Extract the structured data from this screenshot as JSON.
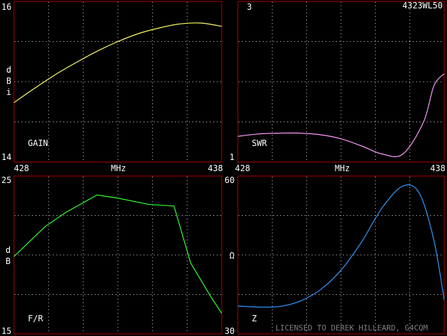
{
  "model_label": "4323WL50",
  "license_text": "LICENSED TO DEREK HILLEARD, G4CQM",
  "colors": {
    "frame": "#b00000",
    "background": "#000000",
    "grid": "#ffffff",
    "text": "#ffffff"
  },
  "chart_data": [
    {
      "id": "gain",
      "type": "line",
      "title": "GAIN",
      "ylabel": "dBi",
      "xlabel": "MHz",
      "xlim": [
        428,
        438
      ],
      "ylim": [
        14,
        16
      ],
      "xtick_labels": [
        "428",
        "438"
      ],
      "ytick_labels": [
        "16",
        "14"
      ],
      "grid": true,
      "line_color": "#ffff66",
      "x": [
        428,
        429,
        430,
        431,
        432,
        433,
        434,
        435,
        436,
        437,
        438
      ],
      "values": [
        14.74,
        14.92,
        15.09,
        15.24,
        15.38,
        15.5,
        15.6,
        15.67,
        15.72,
        15.73,
        15.69
      ]
    },
    {
      "id": "swr",
      "type": "line",
      "title": "SWR",
      "xlabel": "MHz",
      "xlim": [
        428,
        438
      ],
      "ylim": [
        1,
        3
      ],
      "xtick_labels": [
        "428",
        "438"
      ],
      "ytick_labels": [
        "3",
        "1"
      ],
      "grid": true,
      "line_color": "#ff99ff",
      "x": [
        428,
        429,
        430,
        431,
        432,
        433,
        434,
        435,
        436,
        437,
        437.5,
        438
      ],
      "values": [
        1.32,
        1.35,
        1.36,
        1.36,
        1.34,
        1.29,
        1.2,
        1.1,
        1.1,
        1.5,
        1.95,
        2.1
      ]
    },
    {
      "id": "fr",
      "type": "line",
      "title": "F/R",
      "ylabel": "dB",
      "xlim": [
        428,
        438
      ],
      "ylim": [
        15,
        25
      ],
      "ytick_labels": [
        "25",
        "15"
      ],
      "grid": true,
      "line_color": "#33ff33",
      "x": [
        428,
        429.5,
        430.5,
        432,
        433,
        434.5,
        435.7,
        436.5,
        437.5,
        438
      ],
      "values": [
        19.9,
        21.8,
        22.7,
        23.8,
        23.6,
        23.2,
        23.1,
        19.5,
        17.3,
        16.3
      ]
    },
    {
      "id": "z",
      "type": "line",
      "title": "Z",
      "ylabel": "Ω",
      "xlim": [
        428,
        438
      ],
      "ylim": [
        30,
        60
      ],
      "ytick_labels": [
        "60",
        "30"
      ],
      "grid": true,
      "line_color": "#3399ff",
      "x": [
        428,
        429,
        430,
        431,
        432,
        433,
        434,
        435,
        436,
        436.8,
        437.5,
        438
      ],
      "values": [
        35.3,
        35.1,
        35.2,
        36.2,
        38.4,
        42.1,
        47.5,
        54.0,
        58.1,
        56.7,
        47.8,
        36.5
      ]
    }
  ]
}
